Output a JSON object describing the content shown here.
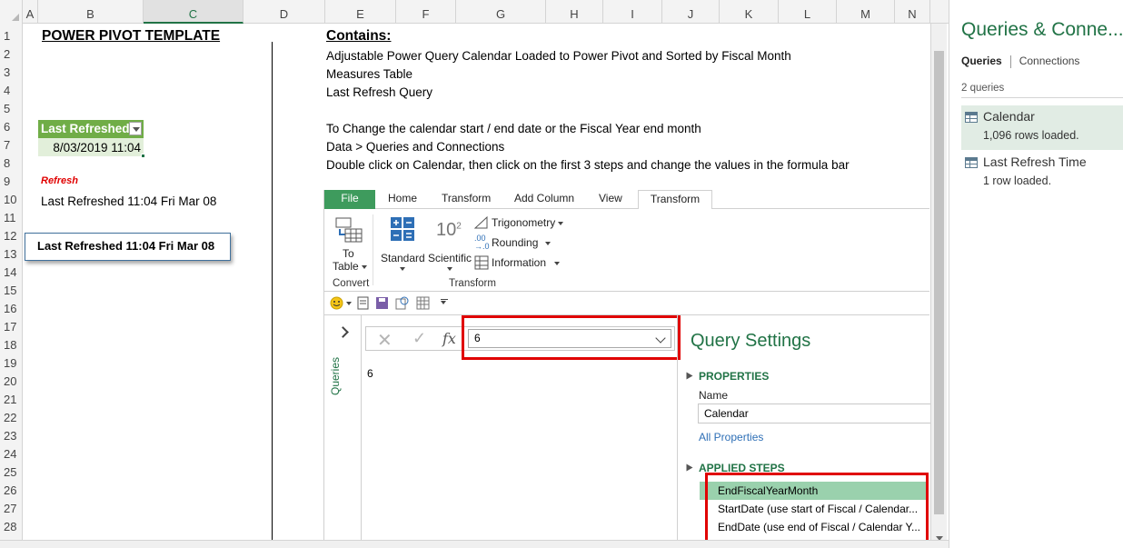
{
  "sheet": {
    "columns": [
      {
        "label": "A",
        "w": 0
      },
      {
        "label": "B"
      },
      {
        "label": "C"
      },
      {
        "label": "D"
      },
      {
        "label": "E"
      },
      {
        "label": "F"
      },
      {
        "label": "G"
      },
      {
        "label": "H"
      },
      {
        "label": "I"
      },
      {
        "label": "J"
      },
      {
        "label": "K"
      },
      {
        "label": "L"
      },
      {
        "label": "M"
      },
      {
        "label": "N"
      }
    ],
    "rows": [
      "1",
      "2",
      "3",
      "4",
      "5",
      "6",
      "7",
      "8",
      "9",
      "10",
      "11",
      "12",
      "13",
      "14",
      "15",
      "16",
      "17",
      "18",
      "19",
      "20",
      "21",
      "22",
      "23",
      "24",
      "25",
      "26",
      "27",
      "28"
    ],
    "title": "POWER PIVOT TEMPLATE",
    "last_refreshed_header": "Last Refreshed",
    "last_refreshed_value": "8/03/2019 11:04",
    "refresh_label": "Refresh",
    "last_refreshed_text": "Last Refreshed 11:04  Fri  Mar 08",
    "shape_text": "Last Refreshed 11:04  Fri  Mar 08",
    "contains_title": "Contains:",
    "contains_lines": [
      "Adjustable Power Query Calendar Loaded to Power Pivot and Sorted by Fiscal Month",
      "Measures Table",
      "Last Refresh Query"
    ],
    "instructions": [
      "To Change the calendar start / end date  or the Fiscal Year end month",
      "Data > Queries and Connections",
      "Double click on Calendar, then click on the first 3 steps and change the values in the formula bar"
    ]
  },
  "power_query": {
    "tabs": [
      "File",
      "Home",
      "Transform",
      "Add Column",
      "View",
      "Transform"
    ],
    "ribbon": {
      "to_table": "To",
      "to_table2": "Table",
      "convert_group": "Convert",
      "standard": "Standard",
      "scientific": "Scientific",
      "trigonometry": "Trigonometry",
      "rounding": "Rounding",
      "information": "Information",
      "transform_group": "Transform",
      "ten_power": "10"
    },
    "nav_label": "Queries",
    "formula_value": "6",
    "cell_value": "6",
    "query_settings_title": "Query Settings",
    "properties_label": "PROPERTIES",
    "name_label": "Name",
    "name_value": "Calendar",
    "all_properties": "All Properties",
    "applied_steps_label": "APPLIED STEPS",
    "steps": [
      {
        "label": "EndFiscalYearMonth",
        "selected": true
      },
      {
        "label": "StartDate (use start of Fiscal / Calendar...",
        "selected": false
      },
      {
        "label": "EndDate (use end of Fiscal / Calendar Y...",
        "selected": false
      }
    ]
  },
  "queries_pane": {
    "title": "Queries & Conne...",
    "tab_queries": "Queries",
    "tab_connections": "Connections",
    "count": "2 queries",
    "items": [
      {
        "name": "Calendar",
        "status": "1,096 rows loaded.",
        "selected": true
      },
      {
        "name": "Last Refresh Time",
        "status": "1 row loaded.",
        "selected": false
      }
    ]
  },
  "colors": {
    "excel_green": "#217346",
    "table_header_green": "#70ad47",
    "highlight_red": "#e00000"
  }
}
